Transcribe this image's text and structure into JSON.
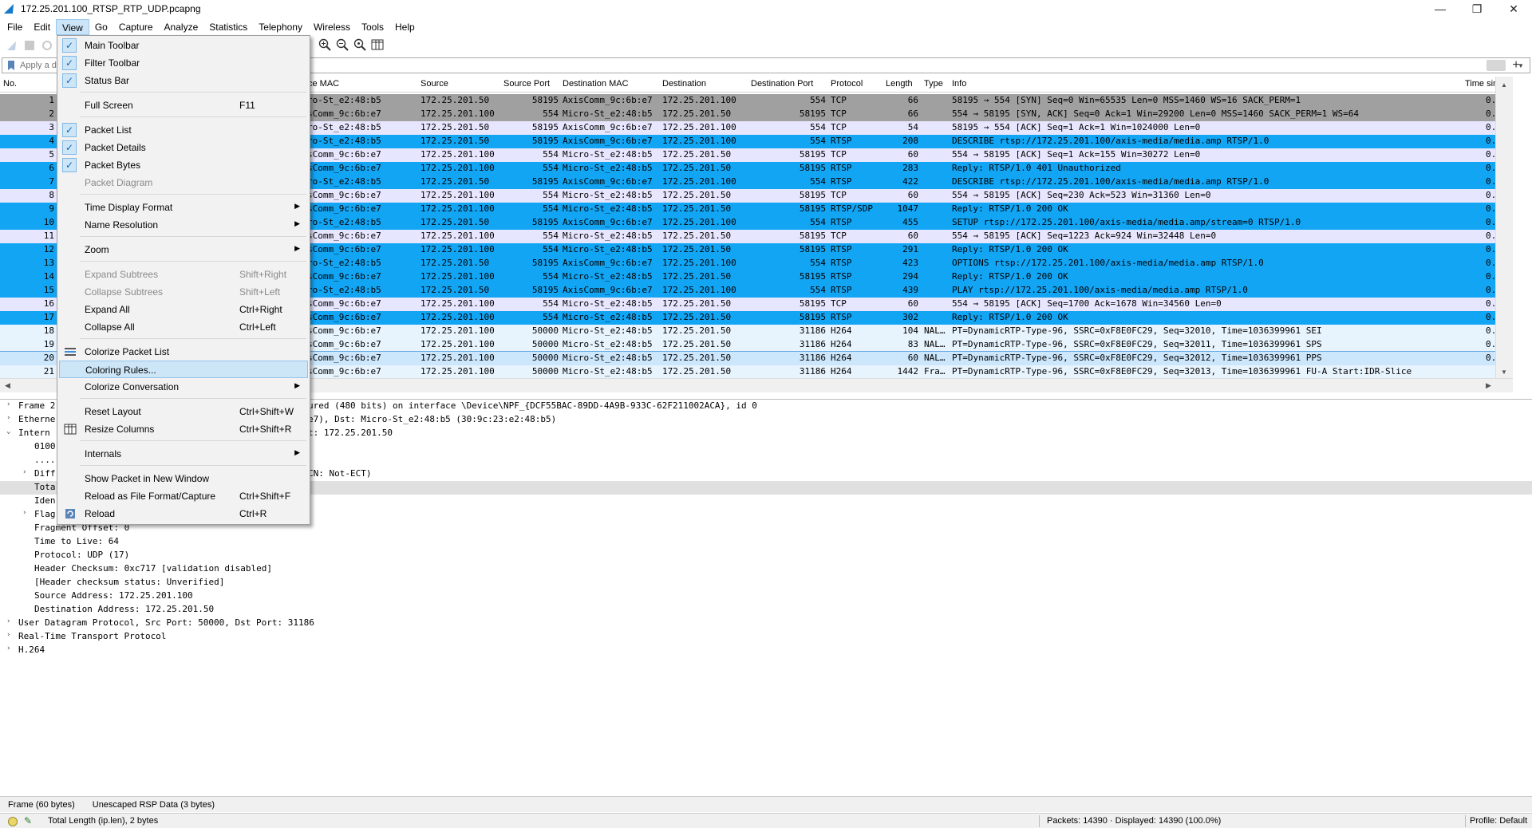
{
  "window": {
    "title": "172.25.201.100_RTSP_RTP_UDP.pcapng",
    "minimize": "—",
    "maximize": "❐",
    "close": "✕"
  },
  "menubar": [
    "File",
    "Edit",
    "View",
    "Go",
    "Capture",
    "Analyze",
    "Statistics",
    "Telephony",
    "Wireless",
    "Tools",
    "Help"
  ],
  "filter": {
    "placeholder": "Apply a di",
    "plus": "+"
  },
  "packet_list": {
    "columns": {
      "no": "No.",
      "src_mac": "ce MAC",
      "source": "Source",
      "src_port": "Source Port",
      "dst_mac": "Destination MAC",
      "destination": "Destination",
      "dst_port": "Destination Port",
      "protocol": "Protocol",
      "length": "Length",
      "type": "Type",
      "info": "Info",
      "time": "Time sin"
    },
    "rows": [
      {
        "no": "1",
        "smac": "ro-St_e2:48:b5",
        "src": "172.25.201.50",
        "sport": "58195",
        "dmac": "AxisComm_9c:6b:e7",
        "dst": "172.25.201.100",
        "dport": "554",
        "proto": "TCP",
        "len": "66",
        "type": "",
        "info": "58195 → 554 [SYN] Seq=0 Win=65535 Len=0 MSS=1460 WS=16 SACK_PERM=1",
        "time": "0.",
        "style": "gray"
      },
      {
        "no": "2",
        "smac": "sComm_9c:6b:e7",
        "src": "172.25.201.100",
        "sport": "554",
        "dmac": "Micro-St_e2:48:b5",
        "dst": "172.25.201.50",
        "dport": "58195",
        "proto": "TCP",
        "len": "66",
        "type": "",
        "info": "554 → 58195 [SYN, ACK] Seq=0 Ack=1 Win=29200 Len=0 MSS=1460 SACK_PERM=1 WS=64",
        "time": "0.",
        "style": "gray"
      },
      {
        "no": "3",
        "smac": "ro-St_e2:48:b5",
        "src": "172.25.201.50",
        "sport": "58195",
        "dmac": "AxisComm_9c:6b:e7",
        "dst": "172.25.201.100",
        "dport": "554",
        "proto": "TCP",
        "len": "54",
        "type": "",
        "info": "58195 → 554 [ACK] Seq=1 Ack=1 Win=1024000 Len=0",
        "time": "0.",
        "style": "light"
      },
      {
        "no": "4",
        "smac": "ro-St_e2:48:b5",
        "src": "172.25.201.50",
        "sport": "58195",
        "dmac": "AxisComm_9c:6b:e7",
        "dst": "172.25.201.100",
        "dport": "554",
        "proto": "RTSP",
        "len": "208",
        "type": "",
        "info": "DESCRIBE rtsp://172.25.201.100/axis-media/media.amp RTSP/1.0",
        "time": "0.",
        "style": "blue"
      },
      {
        "no": "5",
        "smac": "sComm_9c:6b:e7",
        "src": "172.25.201.100",
        "sport": "554",
        "dmac": "Micro-St_e2:48:b5",
        "dst": "172.25.201.50",
        "dport": "58195",
        "proto": "TCP",
        "len": "60",
        "type": "",
        "info": "554 → 58195 [ACK] Seq=1 Ack=155 Win=30272 Len=0",
        "time": "0.",
        "style": "light"
      },
      {
        "no": "6",
        "smac": "sComm_9c:6b:e7",
        "src": "172.25.201.100",
        "sport": "554",
        "dmac": "Micro-St_e2:48:b5",
        "dst": "172.25.201.50",
        "dport": "58195",
        "proto": "RTSP",
        "len": "283",
        "type": "",
        "info": "Reply: RTSP/1.0 401 Unauthorized",
        "time": "0.",
        "style": "blue"
      },
      {
        "no": "7",
        "smac": "ro-St_e2:48:b5",
        "src": "172.25.201.50",
        "sport": "58195",
        "dmac": "AxisComm_9c:6b:e7",
        "dst": "172.25.201.100",
        "dport": "554",
        "proto": "RTSP",
        "len": "422",
        "type": "",
        "info": "DESCRIBE rtsp://172.25.201.100/axis-media/media.amp RTSP/1.0",
        "time": "0.",
        "style": "blue"
      },
      {
        "no": "8",
        "smac": "sComm_9c:6b:e7",
        "src": "172.25.201.100",
        "sport": "554",
        "dmac": "Micro-St_e2:48:b5",
        "dst": "172.25.201.50",
        "dport": "58195",
        "proto": "TCP",
        "len": "60",
        "type": "",
        "info": "554 → 58195 [ACK] Seq=230 Ack=523 Win=31360 Len=0",
        "time": "0.",
        "style": "light"
      },
      {
        "no": "9",
        "smac": "sComm_9c:6b:e7",
        "src": "172.25.201.100",
        "sport": "554",
        "dmac": "Micro-St_e2:48:b5",
        "dst": "172.25.201.50",
        "dport": "58195",
        "proto": "RTSP/SDP",
        "len": "1047",
        "type": "",
        "info": "Reply: RTSP/1.0 200 OK",
        "time": "0.",
        "style": "blue"
      },
      {
        "no": "10",
        "smac": "ro-St_e2:48:b5",
        "src": "172.25.201.50",
        "sport": "58195",
        "dmac": "AxisComm_9c:6b:e7",
        "dst": "172.25.201.100",
        "dport": "554",
        "proto": "RTSP",
        "len": "455",
        "type": "",
        "info": "SETUP rtsp://172.25.201.100/axis-media/media.amp/stream=0 RTSP/1.0",
        "time": "0.",
        "style": "blue"
      },
      {
        "no": "11",
        "smac": "sComm_9c:6b:e7",
        "src": "172.25.201.100",
        "sport": "554",
        "dmac": "Micro-St_e2:48:b5",
        "dst": "172.25.201.50",
        "dport": "58195",
        "proto": "TCP",
        "len": "60",
        "type": "",
        "info": "554 → 58195 [ACK] Seq=1223 Ack=924 Win=32448 Len=0",
        "time": "0.",
        "style": "light"
      },
      {
        "no": "12",
        "smac": "sComm_9c:6b:e7",
        "src": "172.25.201.100",
        "sport": "554",
        "dmac": "Micro-St_e2:48:b5",
        "dst": "172.25.201.50",
        "dport": "58195",
        "proto": "RTSP",
        "len": "291",
        "type": "",
        "info": "Reply: RTSP/1.0 200 OK",
        "time": "0.",
        "style": "blue"
      },
      {
        "no": "13",
        "smac": "ro-St_e2:48:b5",
        "src": "172.25.201.50",
        "sport": "58195",
        "dmac": "AxisComm_9c:6b:e7",
        "dst": "172.25.201.100",
        "dport": "554",
        "proto": "RTSP",
        "len": "423",
        "type": "",
        "info": "OPTIONS rtsp://172.25.201.100/axis-media/media.amp RTSP/1.0",
        "time": "0.",
        "style": "blue"
      },
      {
        "no": "14",
        "smac": "sComm_9c:6b:e7",
        "src": "172.25.201.100",
        "sport": "554",
        "dmac": "Micro-St_e2:48:b5",
        "dst": "172.25.201.50",
        "dport": "58195",
        "proto": "RTSP",
        "len": "294",
        "type": "",
        "info": "Reply: RTSP/1.0 200 OK",
        "time": "0.",
        "style": "blue"
      },
      {
        "no": "15",
        "smac": "ro-St_e2:48:b5",
        "src": "172.25.201.50",
        "sport": "58195",
        "dmac": "AxisComm_9c:6b:e7",
        "dst": "172.25.201.100",
        "dport": "554",
        "proto": "RTSP",
        "len": "439",
        "type": "",
        "info": "PLAY rtsp://172.25.201.100/axis-media/media.amp RTSP/1.0",
        "time": "0.",
        "style": "blue"
      },
      {
        "no": "16",
        "smac": "sComm_9c:6b:e7",
        "src": "172.25.201.100",
        "sport": "554",
        "dmac": "Micro-St_e2:48:b5",
        "dst": "172.25.201.50",
        "dport": "58195",
        "proto": "TCP",
        "len": "60",
        "type": "",
        "info": "554 → 58195 [ACK] Seq=1700 Ack=1678 Win=34560 Len=0",
        "time": "0.",
        "style": "light"
      },
      {
        "no": "17",
        "smac": "sComm_9c:6b:e7",
        "src": "172.25.201.100",
        "sport": "554",
        "dmac": "Micro-St_e2:48:b5",
        "dst": "172.25.201.50",
        "dport": "58195",
        "proto": "RTSP",
        "len": "302",
        "type": "",
        "info": "Reply: RTSP/1.0 200 OK",
        "time": "0.",
        "style": "blue"
      },
      {
        "no": "18",
        "smac": "sComm_9c:6b:e7",
        "src": "172.25.201.100",
        "sport": "50000",
        "dmac": "Micro-St_e2:48:b5",
        "dst": "172.25.201.50",
        "dport": "31186",
        "proto": "H264",
        "len": "104",
        "type": "NAL…",
        "info": "PT=DynamicRTP-Type-96, SSRC=0xF8E0FC29, Seq=32010, Time=1036399961 SEI",
        "time": "0.",
        "style": "pale"
      },
      {
        "no": "19",
        "smac": "sComm_9c:6b:e7",
        "src": "172.25.201.100",
        "sport": "50000",
        "dmac": "Micro-St_e2:48:b5",
        "dst": "172.25.201.50",
        "dport": "31186",
        "proto": "H264",
        "len": "83",
        "type": "NAL…",
        "info": "PT=DynamicRTP-Type-96, SSRC=0xF8E0FC29, Seq=32011, Time=1036399961 SPS",
        "time": "0.",
        "style": "pale"
      },
      {
        "no": "20",
        "smac": "sComm_9c:6b:e7",
        "src": "172.25.201.100",
        "sport": "50000",
        "dmac": "Micro-St_e2:48:b5",
        "dst": "172.25.201.50",
        "dport": "31186",
        "proto": "H264",
        "len": "60",
        "type": "NAL…",
        "info": "PT=DynamicRTP-Type-96, SSRC=0xF8E0FC29, Seq=32012, Time=1036399961 PPS",
        "time": "0.",
        "style": "selected"
      },
      {
        "no": "21",
        "smac": "sComm_9c:6b:e7",
        "src": "172.25.201.100",
        "sport": "50000",
        "dmac": "Micro-St_e2:48:b5",
        "dst": "172.25.201.50",
        "dport": "31186",
        "proto": "H264",
        "len": "1442",
        "type": "Fra…",
        "info": "PT=DynamicRTP-Type-96, SSRC=0xF8E0FC29, Seq=32013, Time=1036399961 FU-A Start:IDR-Slice",
        "time": "",
        "style": "pale"
      }
    ]
  },
  "details": [
    {
      "exp": "›",
      "text": "Frame 2",
      "hl": false
    },
    {
      "exp": "›",
      "text": "Etherne",
      "hl": false
    },
    {
      "exp": "⌄",
      "text": "Intern",
      "hl": false
    },
    {
      "exp": "",
      "text": "0100",
      "hl": false
    },
    {
      "exp": "",
      "text": "....",
      "hl": false
    },
    {
      "exp": "›",
      "text": "Diff",
      "hl": false
    },
    {
      "exp": "",
      "text": "Tota",
      "hl": true
    },
    {
      "exp": "",
      "text": "Iden",
      "hl": false
    },
    {
      "exp": "›",
      "text": "Flag",
      "hl": false
    },
    {
      "exp": "",
      "text": "Fragment Offset: 0",
      "hl": false
    },
    {
      "exp": "",
      "text": "Time to Live: 64",
      "hl": false
    },
    {
      "exp": "",
      "text": "Protocol: UDP (17)",
      "hl": false
    },
    {
      "exp": "",
      "text": "Header Checksum: 0xc717 [validation disabled]",
      "hl": false
    },
    {
      "exp": "",
      "text": "[Header checksum status: Unverified]",
      "hl": false
    },
    {
      "exp": "",
      "text": "Source Address: 172.25.201.100",
      "hl": false
    },
    {
      "exp": "",
      "text": "Destination Address: 172.25.201.50",
      "hl": false
    },
    {
      "exp": "›",
      "text": "User Datagram Protocol, Src Port: 50000, Dst Port: 31186",
      "hl": false
    },
    {
      "exp": "›",
      "text": "Real-Time Transport Protocol",
      "hl": false
    },
    {
      "exp": "›",
      "text": "H.264",
      "hl": false
    }
  ],
  "details_continuations": {
    "frame": "ured (480 bits) on interface \\Device\\NPF_{DCF55BAC-89DD-4A9B-933C-62F211002ACA}, id 0",
    "ethernet": "e7), Dst: Micro-St_e2:48:b5 (30:9c:23:e2:48:b5)",
    "internet": "t: 172.25.201.50",
    "diff": "CN: Not-ECT)"
  },
  "tabs": {
    "frame": "Frame (60 bytes)",
    "rsp": "Unescaped RSP Data (3 bytes)"
  },
  "status": {
    "field": "Total Length (ip.len), 2 bytes",
    "packets": "Packets: 14390 · Displayed: 14390 (100.0%)",
    "profile": "Profile: Default"
  },
  "view_menu": {
    "main_toolbar": "Main Toolbar",
    "filter_toolbar": "Filter Toolbar",
    "status_bar": "Status Bar",
    "full_screen": "Full Screen",
    "full_screen_sc": "F11",
    "packet_list": "Packet List",
    "packet_details": "Packet Details",
    "packet_bytes": "Packet Bytes",
    "packet_diagram": "Packet Diagram",
    "time_display_format": "Time Display Format",
    "name_resolution": "Name Resolution",
    "zoom": "Zoom",
    "expand_subtrees": "Expand Subtrees",
    "expand_subtrees_sc": "Shift+Right",
    "collapse_subtrees": "Collapse Subtrees",
    "collapse_subtrees_sc": "Shift+Left",
    "expand_all": "Expand All",
    "expand_all_sc": "Ctrl+Right",
    "collapse_all": "Collapse All",
    "collapse_all_sc": "Ctrl+Left",
    "colorize_packet_list": "Colorize Packet List",
    "coloring_rules": "Coloring Rules...",
    "colorize_conversation": "Colorize Conversation",
    "reset_layout": "Reset Layout",
    "reset_layout_sc": "Ctrl+Shift+W",
    "resize_columns": "Resize Columns",
    "resize_columns_sc": "Ctrl+Shift+R",
    "internals": "Internals",
    "show_packet_new_window": "Show Packet in New Window",
    "reload_as_file_format": "Reload as File Format/Capture",
    "reload_as_file_format_sc": "Ctrl+Shift+F",
    "reload": "Reload",
    "reload_sc": "Ctrl+R"
  },
  "colors": {
    "row_gray": "#a0a0a0",
    "row_light": "#e7e6ff",
    "row_blue": "#12a5f4",
    "row_pale": "#e7f3fd",
    "row_selected": "#cce6fc",
    "menu_highlight": "#cde6f7"
  }
}
